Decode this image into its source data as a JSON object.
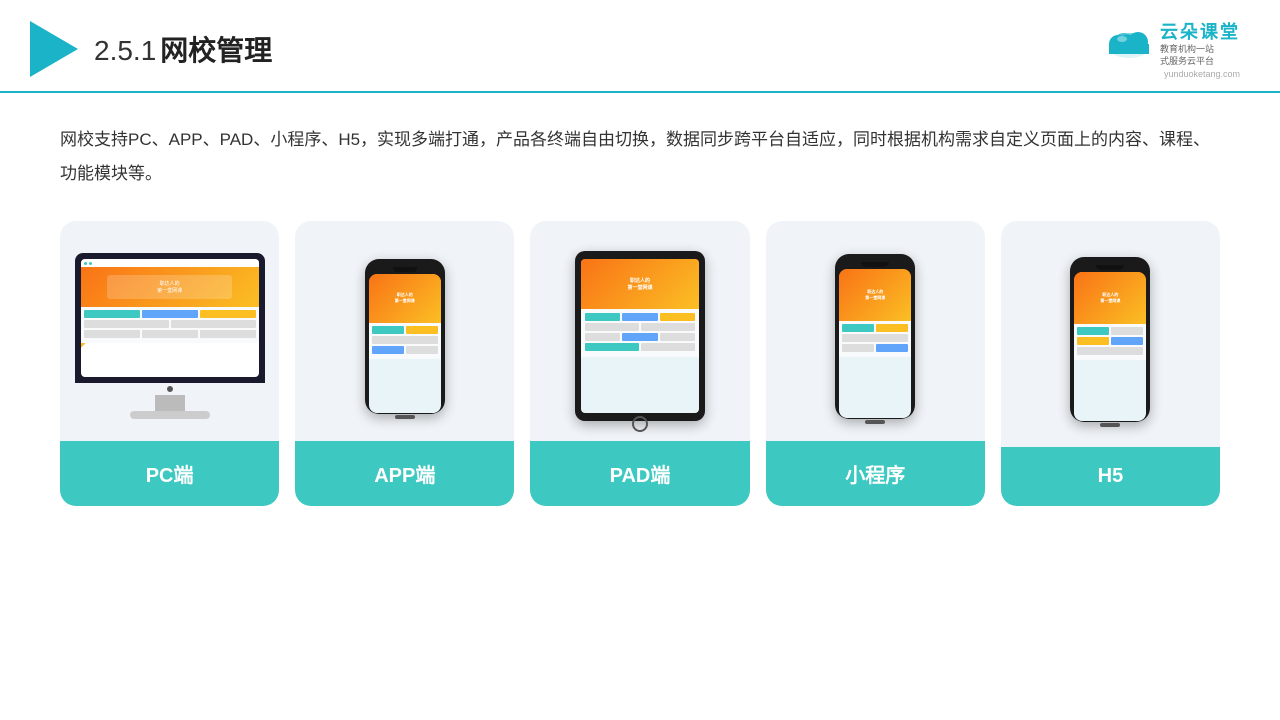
{
  "header": {
    "title": "网校管理",
    "title_prefix": "2.5.1",
    "brand": {
      "name_zh": "云朵课堂",
      "tagline_line1": "教育机构一站",
      "tagline_line2": "式服务云平台",
      "url": "yunduoketang.com"
    }
  },
  "description": "网校支持PC、APP、PAD、小程序、H5，实现多端打通，产品各终端自由切换，数据同步跨平台自适应，同时根据机构需求自定义页面上的内容、课程、功能模块等。",
  "cards": [
    {
      "id": "pc",
      "label": "PC端",
      "type": "pc"
    },
    {
      "id": "app",
      "label": "APP端",
      "type": "mobile"
    },
    {
      "id": "pad",
      "label": "PAD端",
      "type": "tablet"
    },
    {
      "id": "miniprogram",
      "label": "小程序",
      "type": "mobile"
    },
    {
      "id": "h5",
      "label": "H5",
      "type": "mobile"
    }
  ]
}
